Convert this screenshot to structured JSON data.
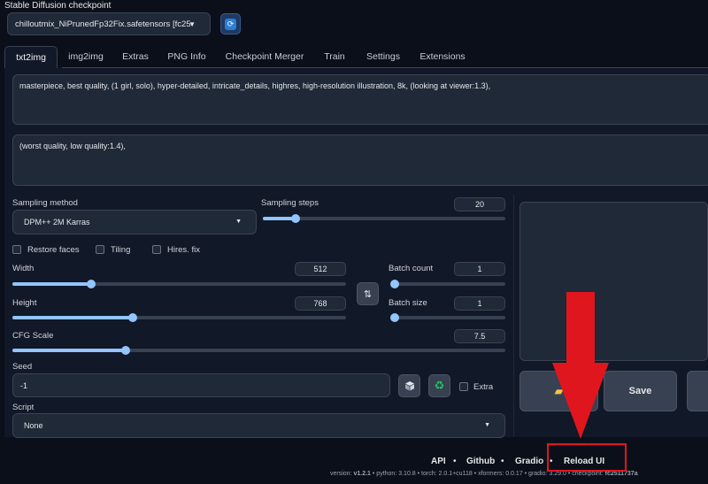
{
  "checkpoint": {
    "title": "Stable Diffusion checkpoint",
    "selected": "chilloutmix_NiPrunedFp32Fix.safetensors [fc25",
    "refresh_icon": "refresh-icon"
  },
  "tabs": [
    {
      "label": "txt2img",
      "active": true
    },
    {
      "label": "img2img"
    },
    {
      "label": "Extras"
    },
    {
      "label": "PNG Info"
    },
    {
      "label": "Checkpoint Merger"
    },
    {
      "label": "Train"
    },
    {
      "label": "Settings"
    },
    {
      "label": "Extensions"
    }
  ],
  "prompts": {
    "positive": "masterpiece, best quality, (1 girl, solo), hyper-detailed, intricate_details, highres, high-resolution illustration, 8k, (looking at viewer:1.3),",
    "negative": "(worst quality, low quality:1.4),"
  },
  "sampling": {
    "method_label": "Sampling method",
    "method_value": "DPM++ 2M Karras",
    "steps_label": "Sampling steps",
    "steps_value": "20",
    "steps_fraction": 0.135
  },
  "checkboxes": {
    "restore_faces": "Restore faces",
    "tiling": "Tiling",
    "hires_fix": "Hires. fix"
  },
  "width": {
    "label": "Width",
    "value": "512",
    "fraction": 0.235
  },
  "height": {
    "label": "Height",
    "value": "768",
    "fraction": 0.36
  },
  "swap_icon": "swap-icon",
  "batch_count": {
    "label": "Batch count",
    "value": "1",
    "fraction": 0.0
  },
  "batch_size": {
    "label": "Batch size",
    "value": "1",
    "fraction": 0.0
  },
  "cfg": {
    "label": "CFG Scale",
    "value": "7.5",
    "fraction": 0.23
  },
  "seed": {
    "label": "Seed",
    "value": "-1",
    "dice_icon": "dice-icon",
    "recycle_icon": "recycle-icon",
    "extra_label": "Extra"
  },
  "script": {
    "label": "Script",
    "value": "None"
  },
  "output": {
    "folder_icon": "folder-icon",
    "save_label": "Save"
  },
  "footer": {
    "links": [
      "API",
      "Github",
      "Gradio",
      "Reload UI"
    ],
    "separator": "•",
    "info": {
      "version_label": "version:",
      "version": "v1.2.1",
      "python_label": "python:",
      "python": "3.10.8",
      "torch_label": "torch:",
      "torch": "2.0.1+cu118",
      "xformers_label": "xformers:",
      "xformers": "0.0.17",
      "gradio_label": "gradio:",
      "gradio": "3.29.0",
      "checkpoint_label": "checkpoint:",
      "checkpoint": "fc2511737a"
    }
  },
  "annotation": {
    "arrow_color": "#e0161e",
    "box_color": "#e0161e"
  }
}
